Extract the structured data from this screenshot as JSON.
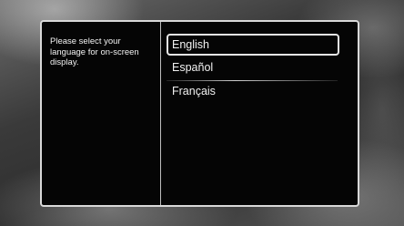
{
  "dialog": {
    "prompt": "Please select your language for on-screen display.",
    "options": [
      {
        "label": "English",
        "selected": true
      },
      {
        "label": "Español",
        "selected": false
      },
      {
        "label": "Français",
        "selected": false
      }
    ]
  },
  "colors": {
    "dialog_background": "#050505",
    "border": "#d9d9d9",
    "text": "#f2f2f2"
  }
}
